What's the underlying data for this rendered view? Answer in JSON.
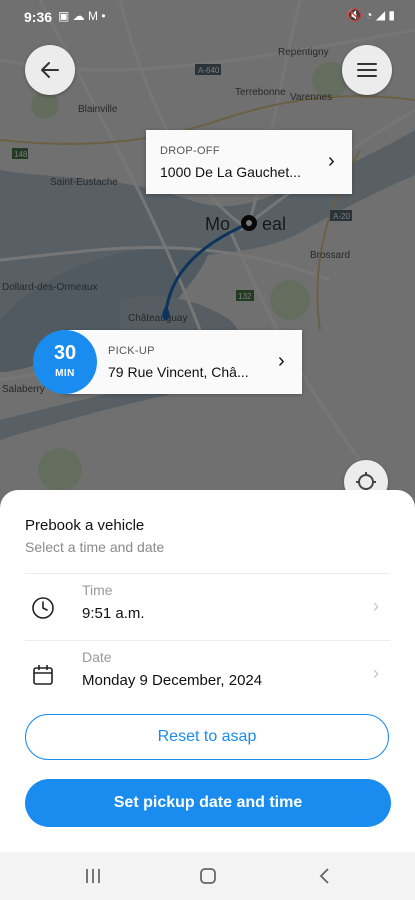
{
  "status_bar": {
    "time": "9:36",
    "left_icons": "▣ ☁ M •",
    "right_icons": "🔇 ◔ ◢ ▮"
  },
  "map": {
    "labels": [
      "Repentigny",
      "Terrebonne",
      "A-640",
      "Blainville",
      "Varennes",
      "Saint-Eustache",
      "148",
      "Mo",
      "eal",
      "Brossard",
      "A-15",
      "A-30",
      "132",
      "A-20",
      "Dollard-des-Ormeaux",
      "Châteauguay",
      "Salaberry"
    ],
    "back_icon": "arrow-left",
    "menu_icon": "hamburger-menu"
  },
  "dropoff_card": {
    "label": "DROP-OFF",
    "address": "1000 De La Gauchet..."
  },
  "pickup_card": {
    "label": "PICK-UP",
    "address": "79 Rue Vincent, Châ..."
  },
  "eta_badge": {
    "value": "30",
    "unit": "MIN"
  },
  "sheet": {
    "title": "Prebook a vehicle",
    "subtitle": "Select a time and date",
    "time_row": {
      "label": "Time",
      "value": "9:51 a.m."
    },
    "date_row": {
      "label": "Date",
      "value": "Monday 9 December, 2024"
    },
    "reset_button": "Reset to asap",
    "set_button": "Set pickup date and time"
  },
  "colors": {
    "accent": "#1a8cef"
  }
}
